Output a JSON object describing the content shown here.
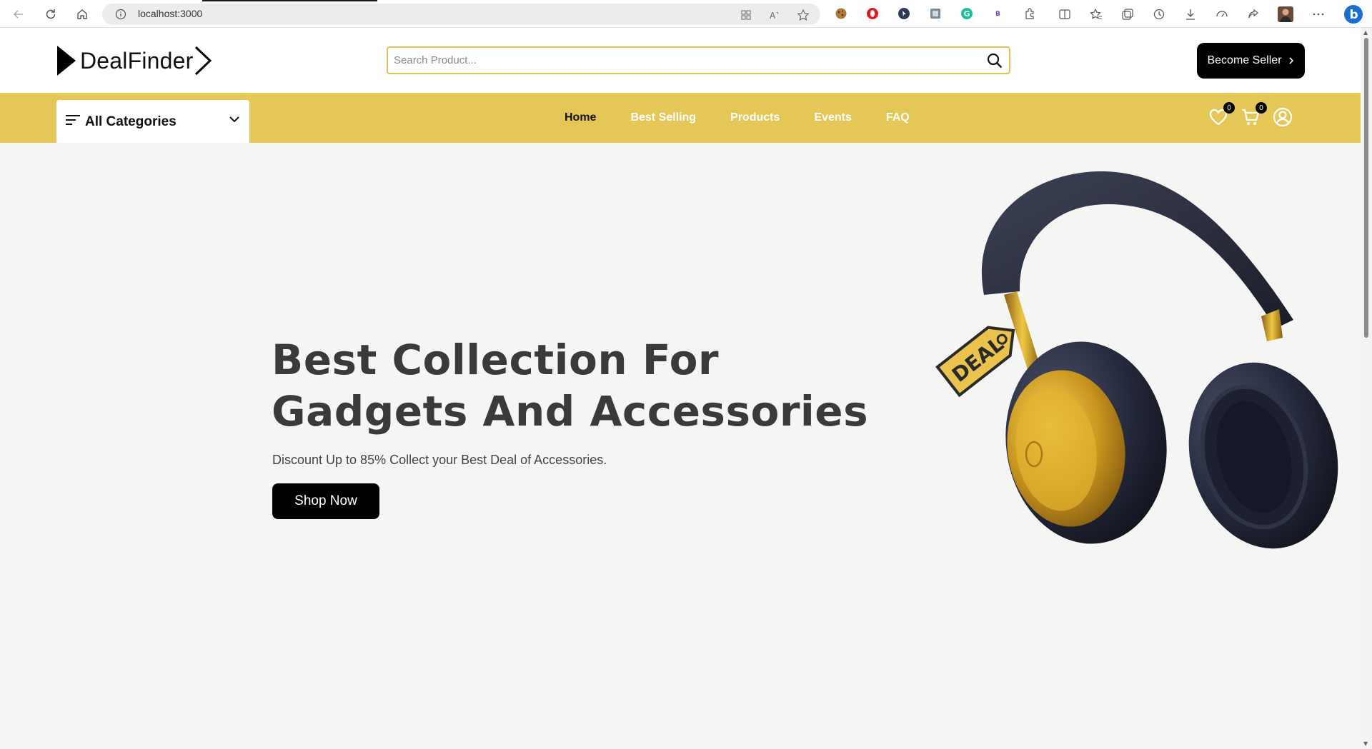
{
  "browser": {
    "url": "localhost:3000"
  },
  "header": {
    "logo_text": "DealFinder",
    "search_placeholder": "Search Product...",
    "become_seller_label": "Become Seller"
  },
  "nav": {
    "categories_label": "All Categories",
    "links": [
      "Home",
      "Best Selling",
      "Products",
      "Events",
      "FAQ"
    ],
    "active_link": "Home",
    "wishlist_count": "0",
    "cart_count": "0"
  },
  "hero": {
    "title_line1": "Best Collection For",
    "title_line2": "Gadgets And Accessories",
    "subtitle": "Discount Up to 85% Collect your Best Deal of Accessories.",
    "cta_label": "Shop Now",
    "image_tag_text": "DEAL"
  },
  "colors": {
    "accent": "#e5c757",
    "search_border": "#e2c15a",
    "button_bg": "#000000",
    "hero_bg": "#f5f5f3"
  }
}
